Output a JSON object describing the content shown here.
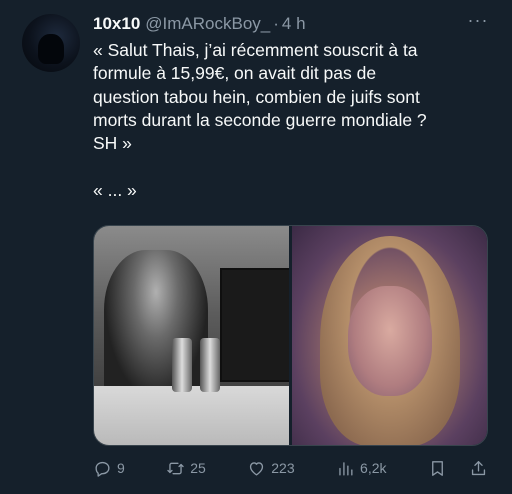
{
  "tweet": {
    "display_name": "10x10",
    "handle": "@ImARockBoy_",
    "separator": "·",
    "time": "4 h",
    "more_label": "···",
    "text": "« Salut Thais, j’ai récemment souscrit à ta\nformule à 15,99€, on avait dit pas de\nquestion tabou hein, combien de juifs sont\nmorts durant la seconde guerre mondiale ?\nSH »\n\n« ... »"
  },
  "actions": {
    "reply_count": "9",
    "retweet_count": "25",
    "like_count": "223",
    "view_count": "6,2k"
  },
  "icons": {
    "avatar": "avatar-image",
    "more": "more-options-icon",
    "reply": "reply-icon",
    "retweet": "retweet-icon",
    "like": "heart-icon",
    "views": "views-chart-icon",
    "bookmark": "bookmark-icon",
    "share": "share-icon"
  },
  "colors": {
    "background": "#15202b",
    "text": "#f7f9f9",
    "muted": "#8b98a5",
    "border": "#38444d"
  }
}
